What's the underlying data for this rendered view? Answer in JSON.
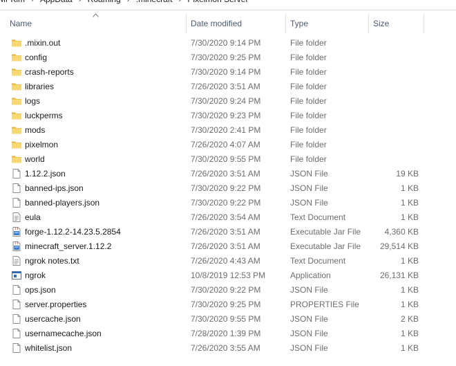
{
  "breadcrumb": [
    "Mr Kim",
    "AppData",
    "Roaming",
    ".minecraft",
    "Pixelmon Server"
  ],
  "columns": {
    "name": "Name",
    "date": "Date modified",
    "type": "Type",
    "size": "Size"
  },
  "files": [
    {
      "name": ".mixin.out",
      "date": "7/30/2020 9:14 PM",
      "type": "File folder",
      "size": "",
      "icon": "folder-icon"
    },
    {
      "name": "config",
      "date": "7/30/2020 9:25 PM",
      "type": "File folder",
      "size": "",
      "icon": "folder-icon"
    },
    {
      "name": "crash-reports",
      "date": "7/30/2020 9:14 PM",
      "type": "File folder",
      "size": "",
      "icon": "folder-icon"
    },
    {
      "name": "libraries",
      "date": "7/26/2020 3:51 AM",
      "type": "File folder",
      "size": "",
      "icon": "folder-icon"
    },
    {
      "name": "logs",
      "date": "7/30/2020 9:24 PM",
      "type": "File folder",
      "size": "",
      "icon": "folder-icon"
    },
    {
      "name": "luckperms",
      "date": "7/30/2020 9:23 PM",
      "type": "File folder",
      "size": "",
      "icon": "folder-icon"
    },
    {
      "name": "mods",
      "date": "7/30/2020 2:41 PM",
      "type": "File folder",
      "size": "",
      "icon": "folder-icon"
    },
    {
      "name": "pixelmon",
      "date": "7/26/2020 4:07 AM",
      "type": "File folder",
      "size": "",
      "icon": "folder-icon"
    },
    {
      "name": "world",
      "date": "7/30/2020 9:55 PM",
      "type": "File folder",
      "size": "",
      "icon": "folder-icon"
    },
    {
      "name": "1.12.2.json",
      "date": "7/26/2020 3:51 AM",
      "type": "JSON File",
      "size": "19 KB",
      "icon": "file-icon"
    },
    {
      "name": "banned-ips.json",
      "date": "7/30/2020 9:22 PM",
      "type": "JSON File",
      "size": "1 KB",
      "icon": "file-icon"
    },
    {
      "name": "banned-players.json",
      "date": "7/30/2020 9:22 PM",
      "type": "JSON File",
      "size": "1 KB",
      "icon": "file-icon"
    },
    {
      "name": "eula",
      "date": "7/26/2020 3:54 AM",
      "type": "Text Document",
      "size": "1 KB",
      "icon": "text-file-icon"
    },
    {
      "name": "forge-1.12.2-14.23.5.2854",
      "date": "7/26/2020 3:51 AM",
      "type": "Executable Jar File",
      "size": "4,360 KB",
      "icon": "jar-file-icon"
    },
    {
      "name": "minecraft_server.1.12.2",
      "date": "7/26/2020 3:51 AM",
      "type": "Executable Jar File",
      "size": "29,514 KB",
      "icon": "jar-file-icon"
    },
    {
      "name": "ngrok notes.txt",
      "date": "7/26/2020 4:43 AM",
      "type": "Text Document",
      "size": "1 KB",
      "icon": "text-file-icon"
    },
    {
      "name": "ngrok",
      "date": "10/8/2019 12:53 PM",
      "type": "Application",
      "size": "26,131 KB",
      "icon": "application-icon"
    },
    {
      "name": "ops.json",
      "date": "7/30/2020 9:22 PM",
      "type": "JSON File",
      "size": "1 KB",
      "icon": "file-icon"
    },
    {
      "name": "server.properties",
      "date": "7/30/2020 9:25 PM",
      "type": "PROPERTIES File",
      "size": "1 KB",
      "icon": "file-icon"
    },
    {
      "name": "usercache.json",
      "date": "7/30/2020 9:55 PM",
      "type": "JSON File",
      "size": "2 KB",
      "icon": "file-icon"
    },
    {
      "name": "usernamecache.json",
      "date": "7/28/2020 1:39 PM",
      "type": "JSON File",
      "size": "1 KB",
      "icon": "file-icon"
    },
    {
      "name": "whitelist.json",
      "date": "7/26/2020 3:55 AM",
      "type": "JSON File",
      "size": "1 KB",
      "icon": "file-icon"
    }
  ],
  "colors": {
    "folder": "#f8d775",
    "folder_dark": "#e2b43c",
    "header_text": "#4a5a70",
    "secondary_text": "#6d6d6d"
  }
}
